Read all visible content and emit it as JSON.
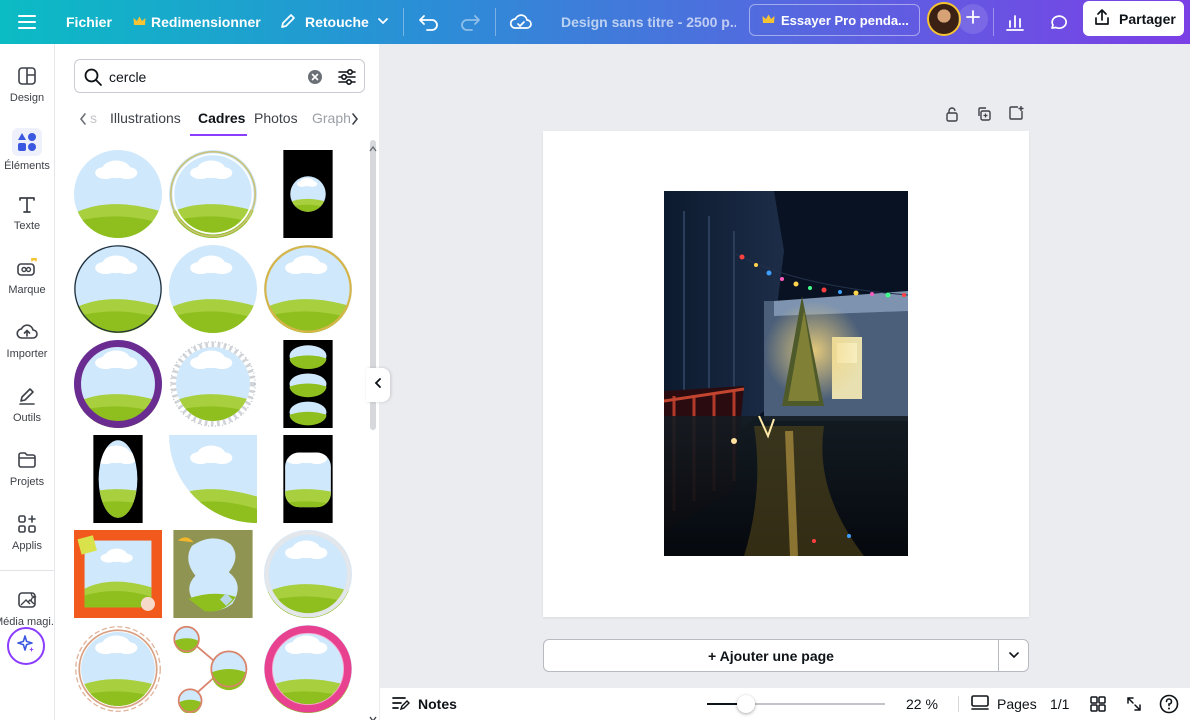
{
  "topbar": {
    "file_label": "Fichier",
    "resize_label": "Redimensionner",
    "retouch_label": "Retouche",
    "doc_title": "Design sans titre - 2500 p...",
    "pro_label": "Essayer Pro penda...",
    "share_label": "Partager",
    "crown_color": "#f6c333"
  },
  "rail": {
    "items": [
      {
        "label": "Design",
        "icon": "design-icon"
      },
      {
        "label": "Éléments",
        "icon": "elements-icon"
      },
      {
        "label": "Texte",
        "icon": "text-icon"
      },
      {
        "label": "Marque",
        "icon": "brand-icon"
      },
      {
        "label": "Importer",
        "icon": "upload-icon"
      },
      {
        "label": "Outils",
        "icon": "tools-icon"
      },
      {
        "label": "Projets",
        "icon": "folder-icon"
      },
      {
        "label": "Applis",
        "icon": "apps-icon"
      },
      {
        "label": "Média magi...",
        "icon": "magic-media-icon"
      }
    ]
  },
  "panel": {
    "search_value": "cercle",
    "tabs": [
      "s",
      "Illustrations",
      "Cadres",
      "Photos",
      "Graph"
    ],
    "active_tab": "Cadres"
  },
  "canvas": {
    "add_page_label": "+ Ajouter une page"
  },
  "bottombar": {
    "notes_label": "Notes",
    "zoom_label": "22 %",
    "zoom_fraction": 0.22,
    "pages_label": "Pages",
    "page_count": "1/1"
  },
  "colors": {
    "accent": "#8b3dff",
    "sky": "#cfe8fb",
    "grass": "#8fbf1f"
  }
}
